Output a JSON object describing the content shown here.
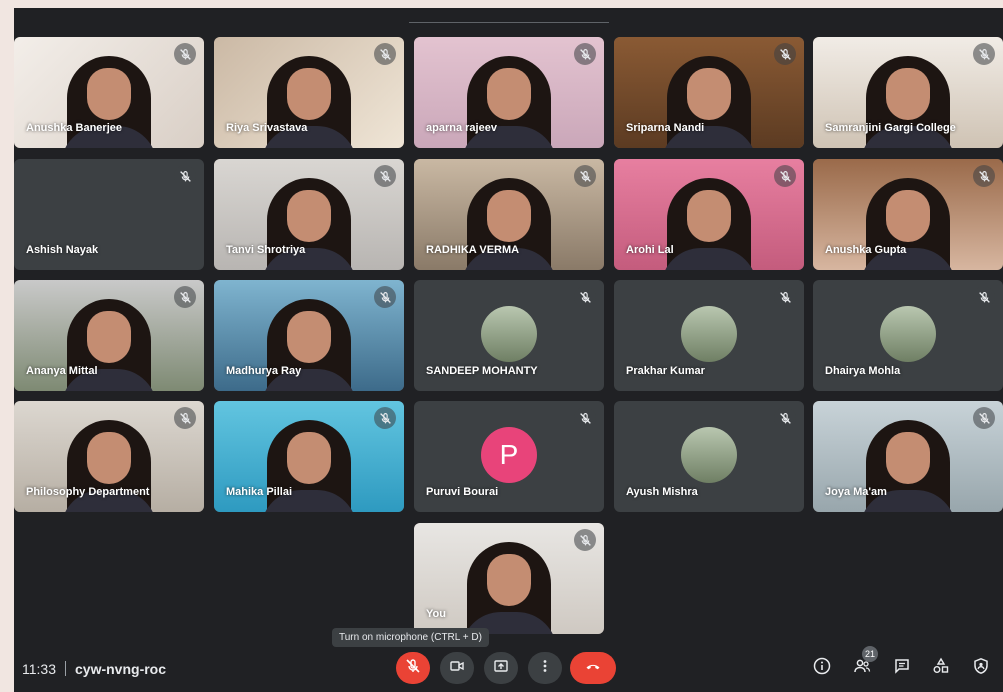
{
  "meeting": {
    "time": "11:33",
    "code": "cyw-nvng-roc",
    "participant_count": "21",
    "tooltip": "Turn on microphone (CTRL + D)"
  },
  "participants": [
    {
      "name": "Anushka Banerjee",
      "type": "video"
    },
    {
      "name": "Riya Srivastava",
      "type": "video"
    },
    {
      "name": "aparna rajeev",
      "type": "video"
    },
    {
      "name": "Sriparna Nandi",
      "type": "video"
    },
    {
      "name": "Samranjini Gargi College",
      "type": "video"
    },
    {
      "name": "Ashish Nayak",
      "type": "empty"
    },
    {
      "name": "Tanvi Shrotriya",
      "type": "video"
    },
    {
      "name": "RADHIKA VERMA",
      "type": "video"
    },
    {
      "name": "Arohi Lal",
      "type": "video"
    },
    {
      "name": "Anushka Gupta",
      "type": "video"
    },
    {
      "name": "Ananya Mittal",
      "type": "video"
    },
    {
      "name": "Madhurya Ray",
      "type": "video"
    },
    {
      "name": "SANDEEP MOHANTY",
      "type": "avatar"
    },
    {
      "name": "Prakhar Kumar",
      "type": "avatar"
    },
    {
      "name": "Dhairya Mohla",
      "type": "avatar"
    },
    {
      "name": "Philosophy Department",
      "type": "video"
    },
    {
      "name": "Mahika Pillai",
      "type": "video"
    },
    {
      "name": "Puruvi Bourai",
      "type": "letter",
      "letter": "P"
    },
    {
      "name": "Ayush Mishra",
      "type": "avatar"
    },
    {
      "name": "Joya Ma'am",
      "type": "video"
    },
    {
      "name": "You",
      "type": "video"
    }
  ],
  "controls": {
    "mic_icon": "mic-off-icon",
    "camera_icon": "videocam-icon",
    "present_icon": "present-screen-icon",
    "more_icon": "more-vert-icon",
    "leave_icon": "call-end-icon"
  },
  "right_icons": [
    "info-icon",
    "people-icon",
    "chat-icon",
    "activities-icon",
    "host-controls-icon"
  ],
  "colors": {
    "background": "#202124",
    "tile": "#3c4043",
    "leave": "#ea4335",
    "letter_avatar": "#e8447a"
  }
}
